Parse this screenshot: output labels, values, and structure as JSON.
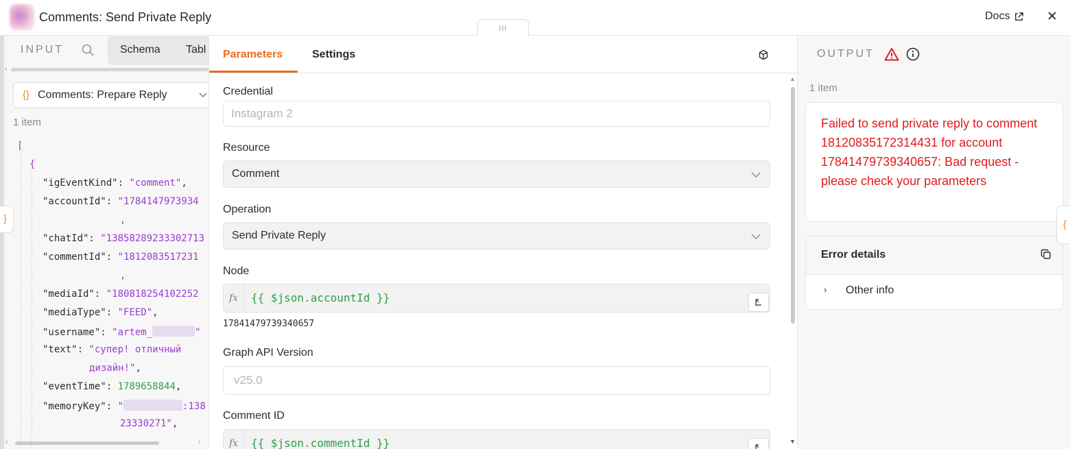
{
  "header": {
    "title": "Comments: Send Private Reply",
    "docs_label": "Docs",
    "close_label": "✕",
    "drag_handle": "III"
  },
  "input": {
    "label": "INPUT",
    "tabs": [
      "Schema",
      "Tabl"
    ],
    "source_node": "Comments: Prepare Reply",
    "item_count": "1 item",
    "json_lines": {
      "l0": "[",
      "l1": "{",
      "l2_key": "\"igEventKind\":",
      "l2_val": "\"comment\"",
      "l3_key": "\"accountId\":",
      "l3_val": "\"1784147973934",
      "l4_key": "\"chatId\":",
      "l4_val": "\"13858289233302713",
      "l5_key": "\"commentId\":",
      "l5_val": "\"1812083517231",
      "l6_key": "\"mediaId\":",
      "l6_val": "\"180818254102252",
      "l7_key": "\"mediaType\":",
      "l7_val": "\"FEED\"",
      "l8_key": "\"username\":",
      "l8_val": "\"artem_",
      "l9_key": "\"text\":",
      "l9_val_a": "\"супер! отличный",
      "l9_val_b": "дизайн!\"",
      "l10_key": "\"eventTime\":",
      "l10_val": "1789658844",
      "l11_key": "\"memoryKey\":",
      "l11_val_b": ":138",
      "l11_val_c": "23330271\""
    }
  },
  "params": {
    "tabs": {
      "parameters": "Parameters",
      "settings": "Settings"
    },
    "credential": {
      "label": "Credential",
      "placeholder": "Instagram 2"
    },
    "resource": {
      "label": "Resource",
      "value": "Comment"
    },
    "operation": {
      "label": "Operation",
      "value": "Send Private Reply"
    },
    "node": {
      "label": "Node",
      "expression": "{{ $json.accountId }}",
      "result": "17841479739340657"
    },
    "graph_api": {
      "label": "Graph API Version",
      "placeholder": "v25.0"
    },
    "comment_id": {
      "label": "Comment ID",
      "expression": "{{ $json.commentId }}"
    }
  },
  "output": {
    "label": "OUTPUT",
    "item_count": "1 item",
    "error_message": "Failed to send private reply to comment 18120835172314431 for account 17841479739340657: Bad request - please check your parameters",
    "error_details_title": "Error details",
    "other_info": "Other info"
  },
  "colors": {
    "accent": "#f06a1d",
    "error": "#e01b1b",
    "json_string": "#9b3bd1",
    "json_number": "#2f9e44"
  }
}
